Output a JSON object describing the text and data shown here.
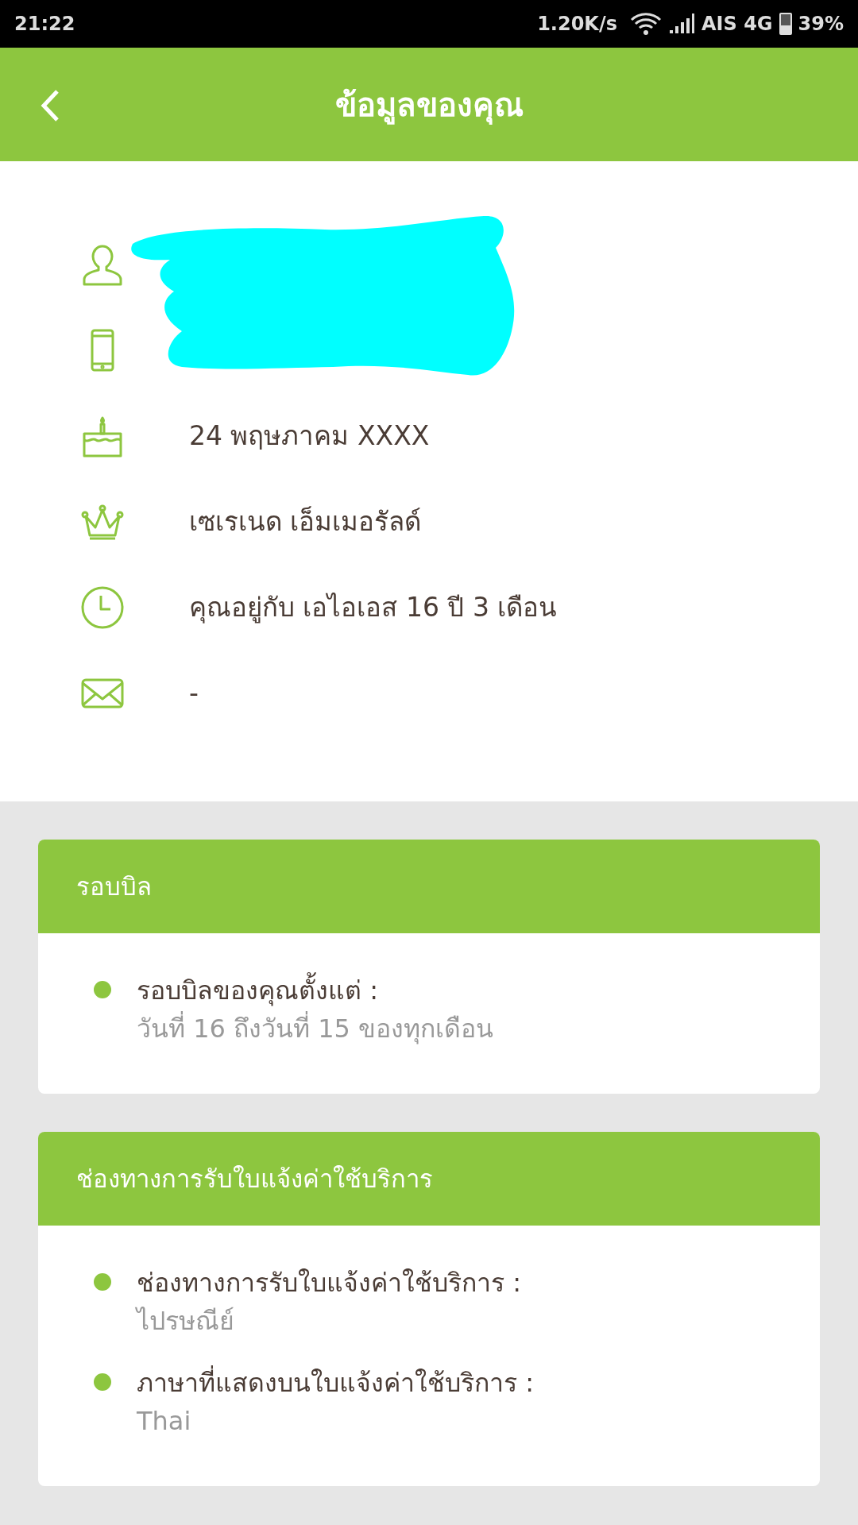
{
  "status_bar": {
    "time": "21:22",
    "speed": "1.20K/s",
    "carrier": "AIS 4G",
    "battery": "39%"
  },
  "header": {
    "title": "ข้อมูลของคุณ"
  },
  "profile": [
    {
      "kind": "person",
      "redacted": true
    },
    {
      "kind": "phone",
      "redacted": true
    },
    {
      "kind": "cake",
      "text": "24 พฤษภาคม XXXX"
    },
    {
      "kind": "crown",
      "text": "เซเรเนด เอ็มเมอรัลด์"
    },
    {
      "kind": "clock",
      "text": "คุณอยู่กับ เอไอเอส 16 ปี 3 เดือน"
    },
    {
      "kind": "mail",
      "text": "-"
    }
  ],
  "cards": [
    {
      "title": "รอบบิล",
      "items": [
        {
          "label": "รอบบิลของคุณตั้งแต่ :",
          "value": "วันที่ 16 ถึงวันที่ 15 ของทุกเดือน"
        }
      ]
    },
    {
      "title": "ช่องทางการรับใบแจ้งค่าใช้บริการ",
      "items": [
        {
          "label": "ช่องทางการรับใบแจ้งค่าใช้บริการ :",
          "value": "ไปรษณีย์"
        },
        {
          "label": "ภาษาที่แสดงบนใบแจ้งค่าใช้บริการ :",
          "value": "Thai"
        }
      ]
    }
  ]
}
